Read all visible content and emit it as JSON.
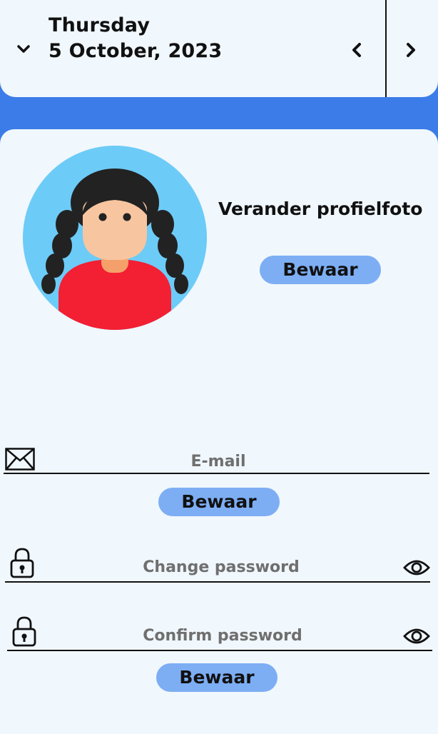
{
  "header": {
    "day": "Thursday",
    "date": "5 October, 2023",
    "icons": {
      "collapse": "chevron-down-icon",
      "prev": "chevron-left-icon",
      "next": "chevron-right-icon"
    }
  },
  "profile": {
    "change_photo_label": "Verander profielfoto",
    "save_label": "Bewaar",
    "avatar_icon": "girl-avatar"
  },
  "email": {
    "placeholder": "E-mail",
    "value": "",
    "icon": "envelope-icon",
    "save_label": "Bewaar"
  },
  "password": {
    "change_placeholder": "Change password",
    "confirm_placeholder": "Confirm password",
    "icons": {
      "lock": "lock-icon",
      "visibility": "eye-icon"
    },
    "save_label": "Bewaar"
  },
  "colors": {
    "background": "#3b7ce8",
    "panel": "#f0f7fd",
    "button": "#7daef4",
    "avatar_bg": "#6dcbf7",
    "hair": "#222222",
    "skin": "#f7c5a0",
    "shirt": "#f31f33"
  }
}
